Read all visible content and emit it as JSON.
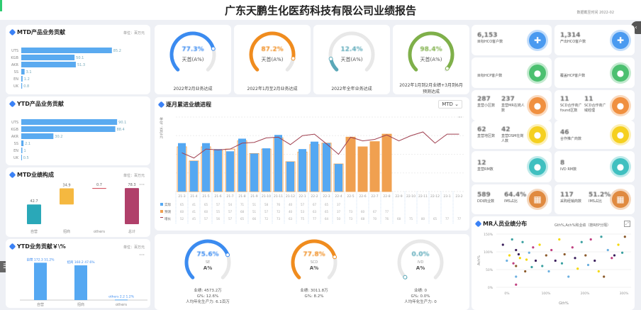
{
  "header": {
    "title": "广东天鹏生化医药科技有限公司业绩报告",
    "data_date": "数据截至时间 2022-02"
  },
  "mtd_product": {
    "title": "MTD产品业务贡献",
    "unit": "单位：百万元",
    "categories": [
      "UTS",
      "KGB",
      "AKR",
      "SS",
      "EN",
      "UK"
    ],
    "values": [
      85.2,
      50.1,
      51.3,
      3.1,
      1.2,
      0.8
    ]
  },
  "ytd_product": {
    "title": "YTD产品业务贡献",
    "categories": [
      "UTS",
      "KGB",
      "AKR",
      "SS",
      "EN",
      "UK"
    ],
    "values": [
      90.1,
      88.4,
      30.2,
      2.1,
      1.0,
      0.5
    ]
  },
  "gauges": [
    {
      "value": "77.3%",
      "label": "天首(A%)",
      "caption": "2022年2月业务达成",
      "pct": 77.3,
      "color": "#3b8bf0"
    },
    {
      "value": "87.2%",
      "label": "天首(A%)",
      "caption": "2022年1月至2月业务达成",
      "pct": 87.2,
      "color": "#f08c1e"
    },
    {
      "value": "12.4%",
      "label": "天首(A%)",
      "caption": "2022年全年业务达成",
      "pct": 12.4,
      "color": "#5aa8b8"
    },
    {
      "value": "98.4%",
      "label": "天首(A%)",
      "caption": "2022年1月到2月业绩+3月到6月预测达成",
      "pct": 98.4,
      "color": "#7fb04a"
    }
  ],
  "stats": {
    "hco_target": {
      "value": "6,153",
      "label": "目标HCO客户数"
    },
    "hco_prod": {
      "value": "1,314",
      "label": "产出HCO客户数"
    },
    "hcp_target": {
      "label": "目标HCP客户数"
    },
    "hcp_cover": {
      "label": "覆盖HCP客户数"
    },
    "dir_area": {
      "value": "287",
      "label": "直营小区数"
    },
    "dir_mr": {
      "value": "237",
      "label": "直营MR在岗人数"
    },
    "scd_area": {
      "value": "11",
      "label": "SCD合作商广found区数"
    },
    "scd_mgr": {
      "value": "11",
      "label": "SCD合作商广域经理"
    },
    "dir_region": {
      "value": "62",
      "label": "直营地区数"
    },
    "dir_dsm": {
      "value": "42",
      "label": "直营DSM在岗人数"
    },
    "partner": {
      "value": "46",
      "label": "合作推广商数"
    },
    "dir_rm": {
      "value": "12",
      "label": "直营RM数"
    },
    "ivd_rm": {
      "value": "8",
      "label": "IVD RM数"
    },
    "ddi": {
      "value": "589",
      "label": "DDI商业数"
    },
    "ims1": {
      "value": "64.4%",
      "label": "IMS占比"
    },
    "buy": {
      "value": "117",
      "label": "采购经销商数"
    },
    "ims2": {
      "value": "51.2%",
      "label": "IMS占比"
    }
  },
  "monthly": {
    "title": "逐月累进业绩进程",
    "select": "MTD",
    "ylabel": "单位：百亿元",
    "legend": [
      "实际",
      "预测",
      "增长"
    ],
    "months": [
      "21-3",
      "21-4",
      "21-5",
      "21-6",
      "21-7",
      "21-8",
      "21-9",
      "21-10",
      "21-11",
      "21-12",
      "22-1",
      "22-2",
      "22-3",
      "22-4",
      "22-5",
      "22-6",
      "22-7",
      "22-8",
      "22-9",
      "22-10",
      "22-11",
      "22-12",
      "23-1",
      "23-2"
    ],
    "actual": [
      65,
      41,
      65,
      57,
      54,
      71,
      51,
      58,
      76,
      40,
      57,
      67,
      65,
      37
    ],
    "target": [
      60,
      41,
      60,
      55,
      57,
      68,
      51,
      57,
      72,
      40,
      53,
      63,
      65,
      37,
      73,
      60,
      67,
      77
    ],
    "growth": [
      52,
      45,
      57,
      56,
      57,
      65,
      66,
      72,
      73,
      63,
      75,
      77,
      64,
      50,
      73,
      68,
      70,
      76,
      68,
      75,
      80,
      65,
      77,
      77
    ]
  },
  "mtd_comp": {
    "title": "MTD业绩构成",
    "unit": "单位：百万元",
    "categories": [
      "自营",
      "招商",
      "others",
      "总计"
    ],
    "values": [
      42.7,
      34.9,
      0.7,
      78.3
    ],
    "labels": [
      "42.7",
      "34.9",
      "0.7",
      "78.3"
    ]
  },
  "ytd_contrib": {
    "title": "YTD业务贡献￥\\%",
    "unit": "单位：百万元",
    "categories": [
      "自营",
      "招商",
      "others"
    ],
    "values": [
      172.3,
      160.2,
      2.2
    ],
    "labels": [
      "自营 172.3 51.2%",
      "招商 160.2 47.6%",
      "others 2.2 1.2%"
    ]
  },
  "bottom_gauges": [
    {
      "value": "75.6%",
      "name": "SE",
      "label": "A%",
      "pct": 75.6,
      "color": "#3b8bf0",
      "lines": [
        "业绩: 4573.2万",
        "G%: 12.6%",
        "人均年化生产力: 6.1百万"
      ]
    },
    {
      "value": "77.8%",
      "name": "SCD",
      "label": "A%",
      "pct": 77.8,
      "color": "#f08c1e",
      "lines": [
        "业绩: 3011.8万",
        "G%: 8.2%"
      ]
    },
    {
      "value": "0.0%",
      "name": "IVD",
      "label": "A%",
      "pct": 0,
      "color": "#5aa8b8",
      "lines": [
        "业绩: 0",
        "G%: 0.0%",
        "人均年化生产力: 0"
      ]
    }
  ],
  "scatter": {
    "title": "MR人员业绩分布",
    "subtitle": "Gth%,Ach%和业绩（按REP分隔）",
    "xlabel": "Gth%",
    "ylabel": "Ach%",
    "yticks": [
      "150%",
      "100%",
      "50%",
      "0%"
    ],
    "xticks": [
      "0%",
      "100%",
      "200%",
      "300%"
    ],
    "points": [
      [
        0.05,
        0.8
      ],
      [
        0.1,
        0.6
      ],
      [
        0.12,
        0.9
      ],
      [
        0.15,
        0.4
      ],
      [
        0.15,
        0.2
      ],
      [
        0.15,
        0.05
      ],
      [
        0.15,
        0.7
      ],
      [
        0.18,
        0.55
      ],
      [
        0.2,
        0.85
      ],
      [
        0.22,
        0.3
      ],
      [
        0.25,
        0.65
      ],
      [
        0.28,
        0.75
      ],
      [
        0.3,
        0.5
      ],
      [
        0.33,
        0.8
      ],
      [
        0.35,
        0.4
      ],
      [
        0.38,
        0.6
      ],
      [
        0.4,
        0.3
      ],
      [
        0.42,
        0.7
      ],
      [
        0.45,
        0.5
      ],
      [
        0.48,
        0.9
      ],
      [
        0.5,
        0.45
      ],
      [
        0.52,
        0.62
      ],
      [
        0.55,
        0.2
      ],
      [
        0.58,
        0.75
      ],
      [
        0.6,
        0.55
      ],
      [
        0.62,
        0.35
      ],
      [
        0.65,
        0.85
      ],
      [
        0.68,
        0.6
      ],
      [
        0.7,
        0.42
      ],
      [
        0.72,
        0.9
      ],
      [
        0.75,
        0.5
      ],
      [
        0.78,
        0.3
      ],
      [
        0.8,
        0.95
      ],
      [
        0.82,
        0.2
      ],
      [
        0.85,
        0.7
      ],
      [
        0.88,
        0.55
      ],
      [
        0.9,
        0.6
      ],
      [
        0.93,
        0.8
      ],
      [
        0.96,
        0.65
      ],
      [
        0.98,
        0.95
      ],
      [
        0.08,
        0.5
      ],
      [
        0.13,
        0.45
      ],
      [
        0.17,
        0.62
      ],
      [
        0.23,
        0.52
      ],
      [
        0.27,
        0.38
      ]
    ],
    "colors": [
      "#3b1f5c",
      "#f5d800",
      "#3aa0a0",
      "#8b5a2b",
      "#6cb0e0",
      "#c04080"
    ]
  },
  "colors": {
    "blue": "#55a8f2",
    "orange": "#f0a050",
    "line": "#b04050"
  }
}
